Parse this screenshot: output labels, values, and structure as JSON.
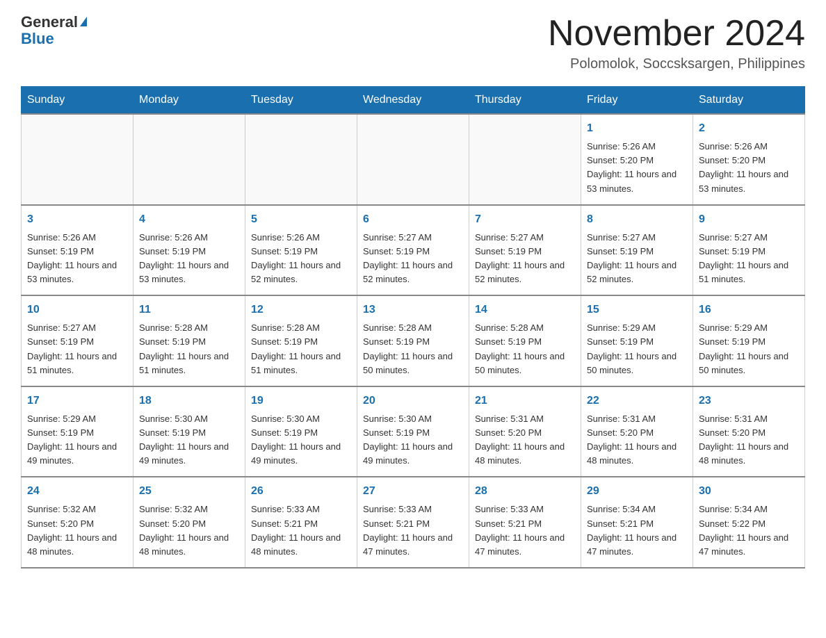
{
  "header": {
    "logo_general": "General",
    "logo_blue": "Blue",
    "month_title": "November 2024",
    "location": "Polomolok, Soccsksargen, Philippines"
  },
  "weekdays": [
    "Sunday",
    "Monday",
    "Tuesday",
    "Wednesday",
    "Thursday",
    "Friday",
    "Saturday"
  ],
  "weeks": [
    [
      {
        "day": "",
        "info": ""
      },
      {
        "day": "",
        "info": ""
      },
      {
        "day": "",
        "info": ""
      },
      {
        "day": "",
        "info": ""
      },
      {
        "day": "",
        "info": ""
      },
      {
        "day": "1",
        "info": "Sunrise: 5:26 AM\nSunset: 5:20 PM\nDaylight: 11 hours and 53 minutes."
      },
      {
        "day": "2",
        "info": "Sunrise: 5:26 AM\nSunset: 5:20 PM\nDaylight: 11 hours and 53 minutes."
      }
    ],
    [
      {
        "day": "3",
        "info": "Sunrise: 5:26 AM\nSunset: 5:19 PM\nDaylight: 11 hours and 53 minutes."
      },
      {
        "day": "4",
        "info": "Sunrise: 5:26 AM\nSunset: 5:19 PM\nDaylight: 11 hours and 53 minutes."
      },
      {
        "day": "5",
        "info": "Sunrise: 5:26 AM\nSunset: 5:19 PM\nDaylight: 11 hours and 52 minutes."
      },
      {
        "day": "6",
        "info": "Sunrise: 5:27 AM\nSunset: 5:19 PM\nDaylight: 11 hours and 52 minutes."
      },
      {
        "day": "7",
        "info": "Sunrise: 5:27 AM\nSunset: 5:19 PM\nDaylight: 11 hours and 52 minutes."
      },
      {
        "day": "8",
        "info": "Sunrise: 5:27 AM\nSunset: 5:19 PM\nDaylight: 11 hours and 52 minutes."
      },
      {
        "day": "9",
        "info": "Sunrise: 5:27 AM\nSunset: 5:19 PM\nDaylight: 11 hours and 51 minutes."
      }
    ],
    [
      {
        "day": "10",
        "info": "Sunrise: 5:27 AM\nSunset: 5:19 PM\nDaylight: 11 hours and 51 minutes."
      },
      {
        "day": "11",
        "info": "Sunrise: 5:28 AM\nSunset: 5:19 PM\nDaylight: 11 hours and 51 minutes."
      },
      {
        "day": "12",
        "info": "Sunrise: 5:28 AM\nSunset: 5:19 PM\nDaylight: 11 hours and 51 minutes."
      },
      {
        "day": "13",
        "info": "Sunrise: 5:28 AM\nSunset: 5:19 PM\nDaylight: 11 hours and 50 minutes."
      },
      {
        "day": "14",
        "info": "Sunrise: 5:28 AM\nSunset: 5:19 PM\nDaylight: 11 hours and 50 minutes."
      },
      {
        "day": "15",
        "info": "Sunrise: 5:29 AM\nSunset: 5:19 PM\nDaylight: 11 hours and 50 minutes."
      },
      {
        "day": "16",
        "info": "Sunrise: 5:29 AM\nSunset: 5:19 PM\nDaylight: 11 hours and 50 minutes."
      }
    ],
    [
      {
        "day": "17",
        "info": "Sunrise: 5:29 AM\nSunset: 5:19 PM\nDaylight: 11 hours and 49 minutes."
      },
      {
        "day": "18",
        "info": "Sunrise: 5:30 AM\nSunset: 5:19 PM\nDaylight: 11 hours and 49 minutes."
      },
      {
        "day": "19",
        "info": "Sunrise: 5:30 AM\nSunset: 5:19 PM\nDaylight: 11 hours and 49 minutes."
      },
      {
        "day": "20",
        "info": "Sunrise: 5:30 AM\nSunset: 5:19 PM\nDaylight: 11 hours and 49 minutes."
      },
      {
        "day": "21",
        "info": "Sunrise: 5:31 AM\nSunset: 5:20 PM\nDaylight: 11 hours and 48 minutes."
      },
      {
        "day": "22",
        "info": "Sunrise: 5:31 AM\nSunset: 5:20 PM\nDaylight: 11 hours and 48 minutes."
      },
      {
        "day": "23",
        "info": "Sunrise: 5:31 AM\nSunset: 5:20 PM\nDaylight: 11 hours and 48 minutes."
      }
    ],
    [
      {
        "day": "24",
        "info": "Sunrise: 5:32 AM\nSunset: 5:20 PM\nDaylight: 11 hours and 48 minutes."
      },
      {
        "day": "25",
        "info": "Sunrise: 5:32 AM\nSunset: 5:20 PM\nDaylight: 11 hours and 48 minutes."
      },
      {
        "day": "26",
        "info": "Sunrise: 5:33 AM\nSunset: 5:21 PM\nDaylight: 11 hours and 48 minutes."
      },
      {
        "day": "27",
        "info": "Sunrise: 5:33 AM\nSunset: 5:21 PM\nDaylight: 11 hours and 47 minutes."
      },
      {
        "day": "28",
        "info": "Sunrise: 5:33 AM\nSunset: 5:21 PM\nDaylight: 11 hours and 47 minutes."
      },
      {
        "day": "29",
        "info": "Sunrise: 5:34 AM\nSunset: 5:21 PM\nDaylight: 11 hours and 47 minutes."
      },
      {
        "day": "30",
        "info": "Sunrise: 5:34 AM\nSunset: 5:22 PM\nDaylight: 11 hours and 47 minutes."
      }
    ]
  ]
}
